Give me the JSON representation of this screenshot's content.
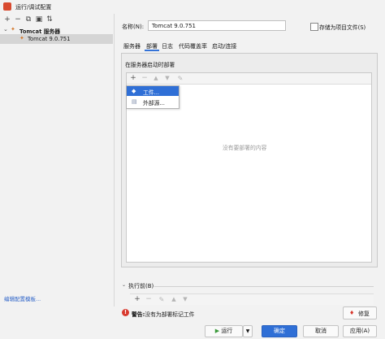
{
  "window": {
    "title": "运行/调试配置"
  },
  "left_toolbar": {
    "icons": [
      "plus-icon",
      "minus-icon",
      "copy-icon",
      "folder-icon",
      "sort-icon"
    ]
  },
  "tree": {
    "group_label": "Tomcat 服务器",
    "item_label": "Tomcat 9.0.751"
  },
  "left_footer": {
    "edit_templates": "编辑配置模板..."
  },
  "form": {
    "name_label": "名称(N):",
    "name_value": "Tomcat 9.0.751",
    "store_label": "存储为项目文件(S)"
  },
  "tabs": [
    "服务器",
    "部署",
    "日志",
    "代码覆盖率",
    "启动/连接"
  ],
  "deployment": {
    "section_title": "在服务器启动时部署",
    "empty_text": "没有要部署的内容",
    "popup_items": [
      "工件...",
      "外部源..."
    ]
  },
  "before_launch": {
    "label": "执行前(B)"
  },
  "warning": {
    "prefix": "警告:",
    "message": "没有为部署标记工件",
    "fix_label": "修复"
  },
  "buttons": {
    "run": "运行",
    "ok": "确定",
    "cancel": "取消",
    "apply": "应用(A)"
  },
  "colors": {
    "accent": "#2f6fd6",
    "error": "#d83a2f",
    "link": "#2f65c9"
  }
}
